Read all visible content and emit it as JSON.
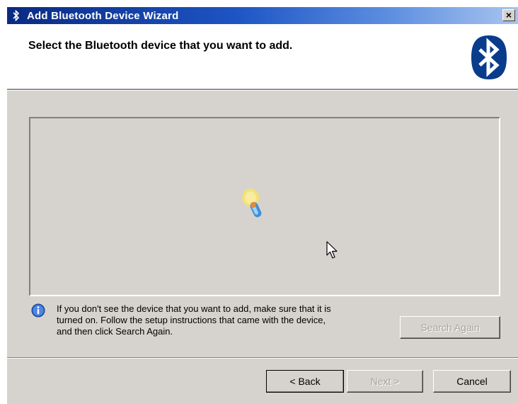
{
  "window": {
    "title": "Add Bluetooth Device Wizard",
    "close_label": "×"
  },
  "header": {
    "instruction": "Select the Bluetooth device that you want to add.",
    "logo_icon": "bluetooth-logo",
    "logo_color": "#0a3c8c"
  },
  "device_list": {
    "state_icon": "searching-animation-icon"
  },
  "info": {
    "icon": "info-icon",
    "lines": [
      "If you don't see the device that you want to add, make sure that it is",
      "turned on. Follow the setup instructions that came with the device,",
      "and then click Search Again."
    ]
  },
  "buttons": {
    "search_again": "Search Again",
    "back": "< Back",
    "next": "Next >",
    "cancel": "Cancel"
  }
}
